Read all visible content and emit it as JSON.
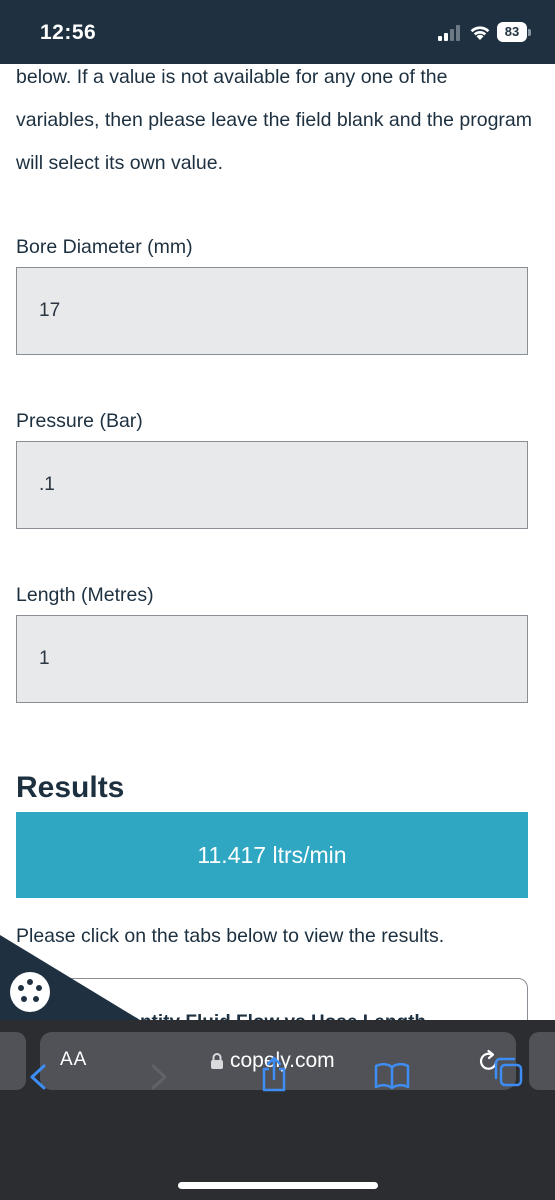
{
  "status_bar": {
    "time": "12:56",
    "battery": "83"
  },
  "intro_text": "below. If a value is not available for any one of the variables, then please leave the field blank and the program will select its own value.",
  "fields": [
    {
      "label": "Bore Diameter (mm)",
      "value": "17"
    },
    {
      "label": "Pressure (Bar)",
      "value": ".1"
    },
    {
      "label": "Length (Metres)",
      "value": "1"
    }
  ],
  "results": {
    "title": "Results",
    "value": "11.417 ltrs/min",
    "hint": "Please click on the tabs below to view the results.",
    "tab_label": "Quantity Fluid Flow vs Hose Length"
  },
  "browser": {
    "aa_label": "AA",
    "url": "copely.com"
  },
  "colors": {
    "status_bar_bg": "#1f3141",
    "results_bg": "#2fa7c2",
    "input_bg": "#e8e9eb",
    "toolbar_bg": "#2b2d30"
  }
}
